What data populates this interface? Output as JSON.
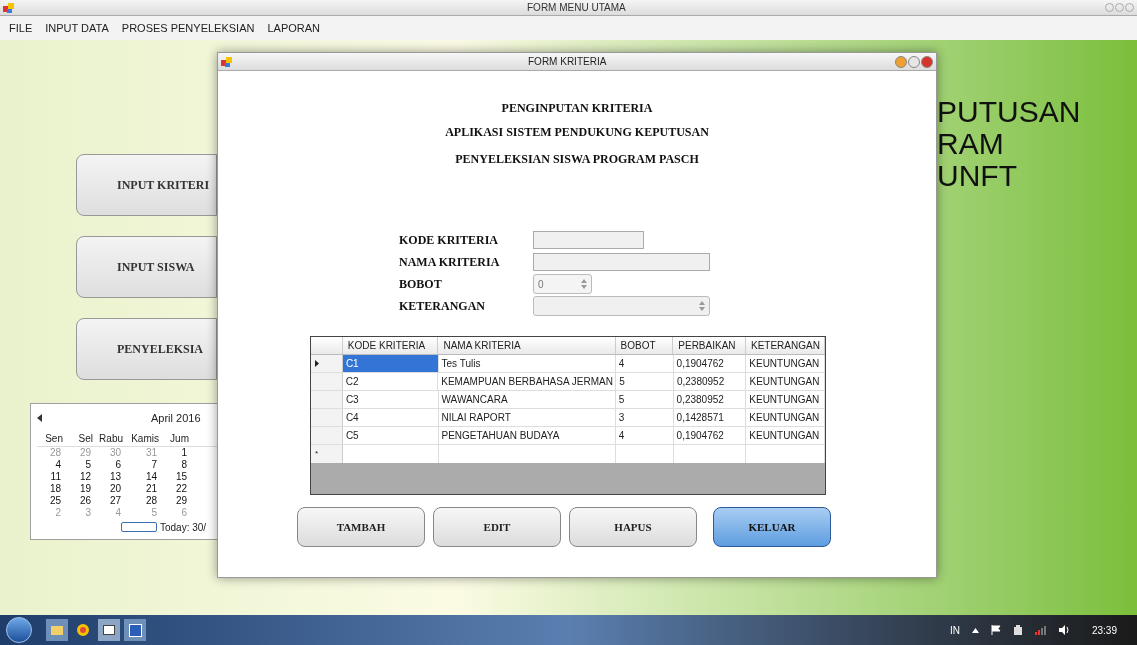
{
  "main_window": {
    "title": "FORM MENU UTAMA"
  },
  "menu": [
    {
      "label": "FILE"
    },
    {
      "label": "INPUT DATA"
    },
    {
      "label": "PROSES PENYELEKSIAN"
    },
    {
      "label": "LAPORAN"
    }
  ],
  "banner_lines": [
    "PUTUSAN",
    "RAM",
    "UNFT"
  ],
  "side_buttons": [
    "INPUT KRITERI",
    "INPUT SISWA",
    "PENYELEKSIA"
  ],
  "calendar": {
    "month": "April 2016",
    "weekdays": [
      "Sen",
      "Sel",
      "Rabu",
      "Kamis",
      "Jum"
    ],
    "weeks": [
      [
        {
          "day": "28",
          "current": false
        },
        {
          "day": "29",
          "current": false
        },
        {
          "day": "30",
          "current": false
        },
        {
          "day": "31",
          "current": false
        },
        {
          "day": "1",
          "current": true
        }
      ],
      [
        {
          "day": "4",
          "current": true
        },
        {
          "day": "5",
          "current": true
        },
        {
          "day": "6",
          "current": true
        },
        {
          "day": "7",
          "current": true
        },
        {
          "day": "8",
          "current": true
        }
      ],
      [
        {
          "day": "11",
          "current": true
        },
        {
          "day": "12",
          "current": true
        },
        {
          "day": "13",
          "current": true
        },
        {
          "day": "14",
          "current": true
        },
        {
          "day": "15",
          "current": true
        }
      ],
      [
        {
          "day": "18",
          "current": true
        },
        {
          "day": "19",
          "current": true
        },
        {
          "day": "20",
          "current": true
        },
        {
          "day": "21",
          "current": true
        },
        {
          "day": "22",
          "current": true
        }
      ],
      [
        {
          "day": "25",
          "current": true
        },
        {
          "day": "26",
          "current": true
        },
        {
          "day": "27",
          "current": true
        },
        {
          "day": "28",
          "current": true
        },
        {
          "day": "29",
          "current": true
        }
      ],
      [
        {
          "day": "2",
          "current": false
        },
        {
          "day": "3",
          "current": false
        },
        {
          "day": "4",
          "current": false
        },
        {
          "day": "5",
          "current": false
        },
        {
          "day": "6",
          "current": false
        }
      ]
    ],
    "today": "Today: 30/"
  },
  "dialog": {
    "title": "FORM KRITERIA",
    "headings": [
      "PENGINPUTAN KRITERIA",
      "APLIKASI SISTEM PENDUKUNG KEPUTUSAN",
      "PENYELEKSIAN SISWA PROGRAM PASCH"
    ],
    "fields": [
      {
        "label": "KODE KRITERIA",
        "kind": "text"
      },
      {
        "label": "NAMA KRITERIA",
        "kind": "text_wide"
      },
      {
        "label": "BOBOT",
        "kind": "spin",
        "value": "0"
      },
      {
        "label": "KETERANGAN",
        "kind": "select"
      }
    ],
    "table": {
      "columns": [
        "KODE KRITERIA",
        "NAMA KRITERIA",
        "BOBOT",
        "PERBAIKAN",
        "KETERANGAN"
      ],
      "rows": [
        {
          "cells": [
            "C1",
            "Tes Tulis",
            "4",
            "0,1904762",
            "KEUNTUNGAN"
          ],
          "selected": true
        },
        {
          "cells": [
            "C2",
            "KEMAMPUAN BERBAHASA JERMAN",
            "5",
            "0,2380952",
            "KEUNTUNGAN"
          ],
          "selected": false
        },
        {
          "cells": [
            "C3",
            "WAWANCARA",
            "5",
            "0,2380952",
            "KEUNTUNGAN"
          ],
          "selected": false
        },
        {
          "cells": [
            "C4",
            "NILAI RAPORT",
            "3",
            "0,1428571",
            "KEUNTUNGAN"
          ],
          "selected": false
        },
        {
          "cells": [
            "C5",
            "PENGETAHUAN BUDAYA",
            "4",
            "0,1904762",
            "KEUNTUNGAN"
          ],
          "selected": false
        }
      ],
      "new_row_marker": "*"
    },
    "buttons": [
      {
        "label": "TAMBAH",
        "focused": false
      },
      {
        "label": "EDIT",
        "focused": false
      },
      {
        "label": "HAPUS",
        "focused": false
      },
      {
        "label": "KELUAR",
        "focused": true
      }
    ]
  },
  "taskbar": {
    "language": "IN",
    "clock": "23:39"
  }
}
